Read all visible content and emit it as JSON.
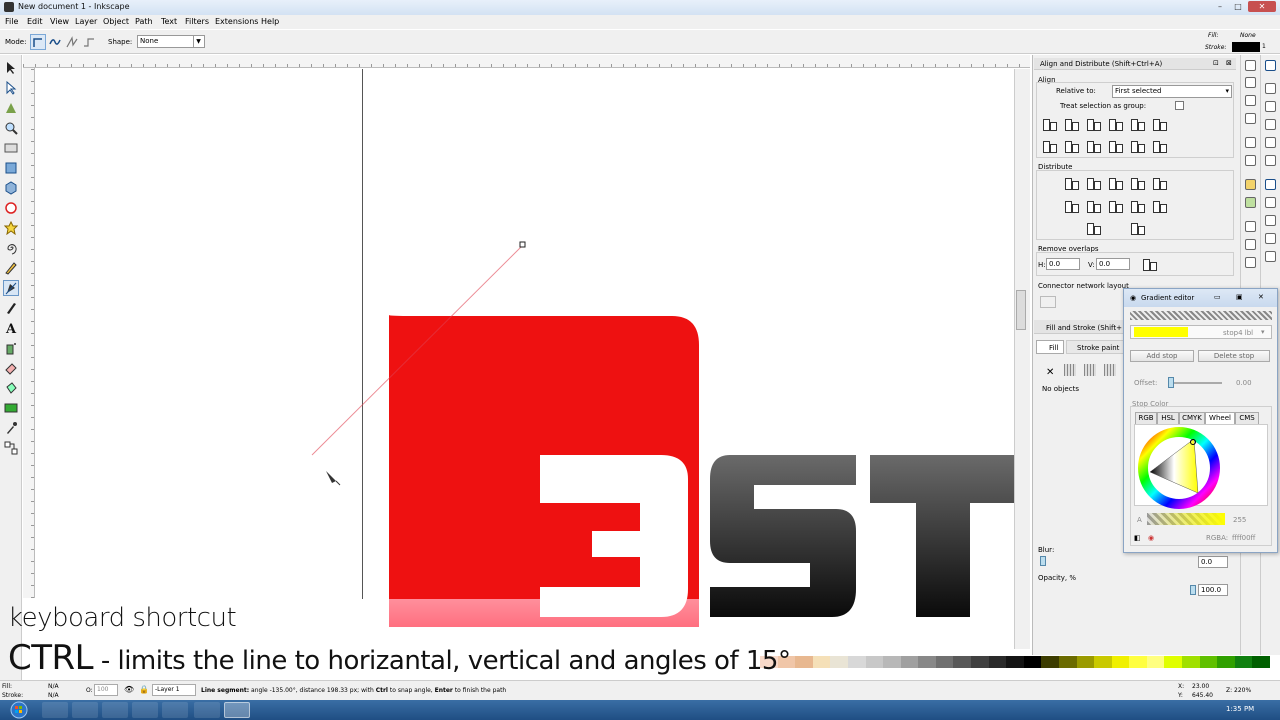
{
  "window": {
    "title": "New document 1 - Inkscape",
    "min": "–",
    "max": "□",
    "close": "✕"
  },
  "menu": [
    "File",
    "Edit",
    "View",
    "Layer",
    "Object",
    "Path",
    "Text",
    "Filters",
    "Extensions",
    "Help"
  ],
  "toolctrl": {
    "mode_label": "Mode:",
    "shape_label": "Shape:",
    "shape_value": "None"
  },
  "style_indicator": {
    "fill_label": "Fill:",
    "fill_value": "None",
    "stroke_label": "Stroke:",
    "stroke_value": "1"
  },
  "align": {
    "title": "Align and Distribute (Shift+Ctrl+A)",
    "section_align": "Align",
    "relative_label": "Relative to:",
    "relative_value": "First selected",
    "treat_group": "Treat selection as group:",
    "section_distribute": "Distribute",
    "section_overlaps": "Remove overlaps",
    "h_label": "H:",
    "h_value": "0.0",
    "v_label": "V:",
    "v_value": "0.0",
    "connector_label": "Connector network layout"
  },
  "fill_stroke": {
    "title": "Fill and Stroke (Shift+",
    "tab_fill": "Fill",
    "tab_stroke_paint": "Stroke paint",
    "no_objects": "No objects",
    "blur_label": "Blur:",
    "blur_value": "0.0",
    "opacity_label": "Opacity, %",
    "opacity_value": "100.0"
  },
  "gradient_editor": {
    "title": "Gradient editor",
    "stop_label": "stop4 lbl",
    "add_stop": "Add stop",
    "delete_stop": "Delete stop",
    "offset_label": "Offset:",
    "offset_value": "0.00",
    "stop_color_label": "Stop Color",
    "tabs": [
      "RGB",
      "HSL",
      "CMYK",
      "Wheel",
      "CMS"
    ],
    "alpha_label": "A",
    "alpha_value": "255",
    "rgba_label": "RGBA:",
    "rgba_value": "ffff00ff",
    "stop_color_hex": "#ffff00"
  },
  "canvas": {
    "logo_digit": "3",
    "logo_letters": "ST",
    "logo_red": "#ee1111"
  },
  "caption": {
    "line1": "keyboard shortcut",
    "key": "CTRL",
    "line2": " - limits the line to horizantal, vertical and angles of 15°"
  },
  "status": {
    "fill_label": "Fill:",
    "fill_value": "N/A",
    "stroke_label": "Stroke:",
    "stroke_value": "N/A",
    "opacity_label": "O:",
    "opacity_value": "100",
    "layer_value": "-Layer 1",
    "message_bold1": "Line segment:",
    "message1": " angle -135.00°, distance 198.33 px; with ",
    "message_bold2": "Ctrl",
    "message2": " to snap angle, ",
    "message_bold3": "Enter",
    "message3": " to finish the path",
    "x_label": "X:",
    "x_value": "23.00",
    "y_label": "Y:",
    "y_value": "645.40",
    "z_label": "Z:",
    "zoom_value": "220%"
  },
  "taskbar": {
    "clock": "1:35 PM"
  },
  "palette_colors": [
    "#f7d9c9",
    "#f0c6a8",
    "#e8b890",
    "#f5e0b8",
    "#e9e4d5",
    "#d8d8d8",
    "#c8c8c8",
    "#b8b8b8",
    "#a0a0a0",
    "#888888",
    "#707070",
    "#585858",
    "#404040",
    "#2a2a2a",
    "#141414",
    "#000000",
    "#3c3c00",
    "#6b6b00",
    "#9a9a00",
    "#c9c900",
    "#f0f000",
    "#ffff40",
    "#ffff80",
    "#e0ff00",
    "#a0e000",
    "#60c000",
    "#30a000",
    "#108010",
    "#006000"
  ]
}
